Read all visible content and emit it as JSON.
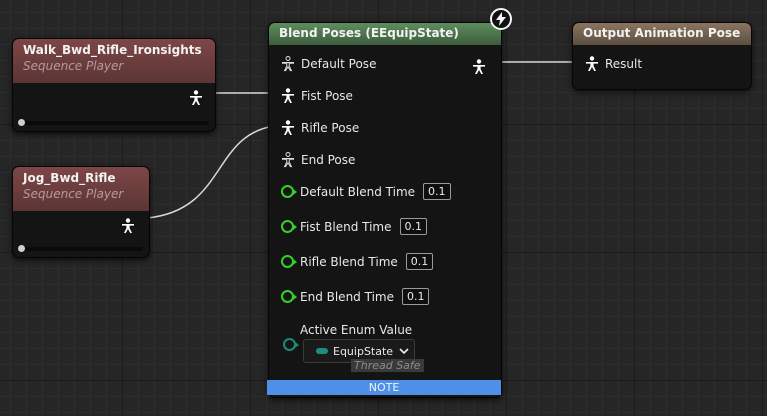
{
  "nodes": {
    "walk_seq": {
      "title": "Walk_Bwd_Rifle_Ironsights",
      "subtitle": "Sequence Player"
    },
    "jog_seq": {
      "title": "Jog_Bwd_Rifle",
      "subtitle": "Sequence Player"
    },
    "blend": {
      "title": "Blend Poses (EEquipState)",
      "pose_pins": [
        "Default Pose",
        "Fist Pose",
        "Rifle Pose",
        "End Pose"
      ],
      "blend_times": [
        {
          "label": "Default Blend Time",
          "value": "0.1"
        },
        {
          "label": "Fist Blend Time",
          "value": "0.1"
        },
        {
          "label": "Rifle Blend Time",
          "value": "0.1"
        },
        {
          "label": "End Blend Time",
          "value": "0.1"
        }
      ],
      "enum_label": "Active Enum Value",
      "enum_value": "EquipState",
      "thread_safe": "Thread Safe",
      "note": "NOTE"
    },
    "output": {
      "title": "Output Animation Pose",
      "result_label": "Result"
    }
  },
  "colors": {
    "sequence_header": "#7e4646",
    "blend_header": "#5f8d5f",
    "output_header": "#8a7560",
    "float_pin": "#36d02a",
    "enum_pin": "#1a8a7a",
    "note_bar": "#4e8fe8"
  },
  "icons": [
    "pose-person-icon",
    "lightning-bolt-icon",
    "chevron-down-icon"
  ]
}
